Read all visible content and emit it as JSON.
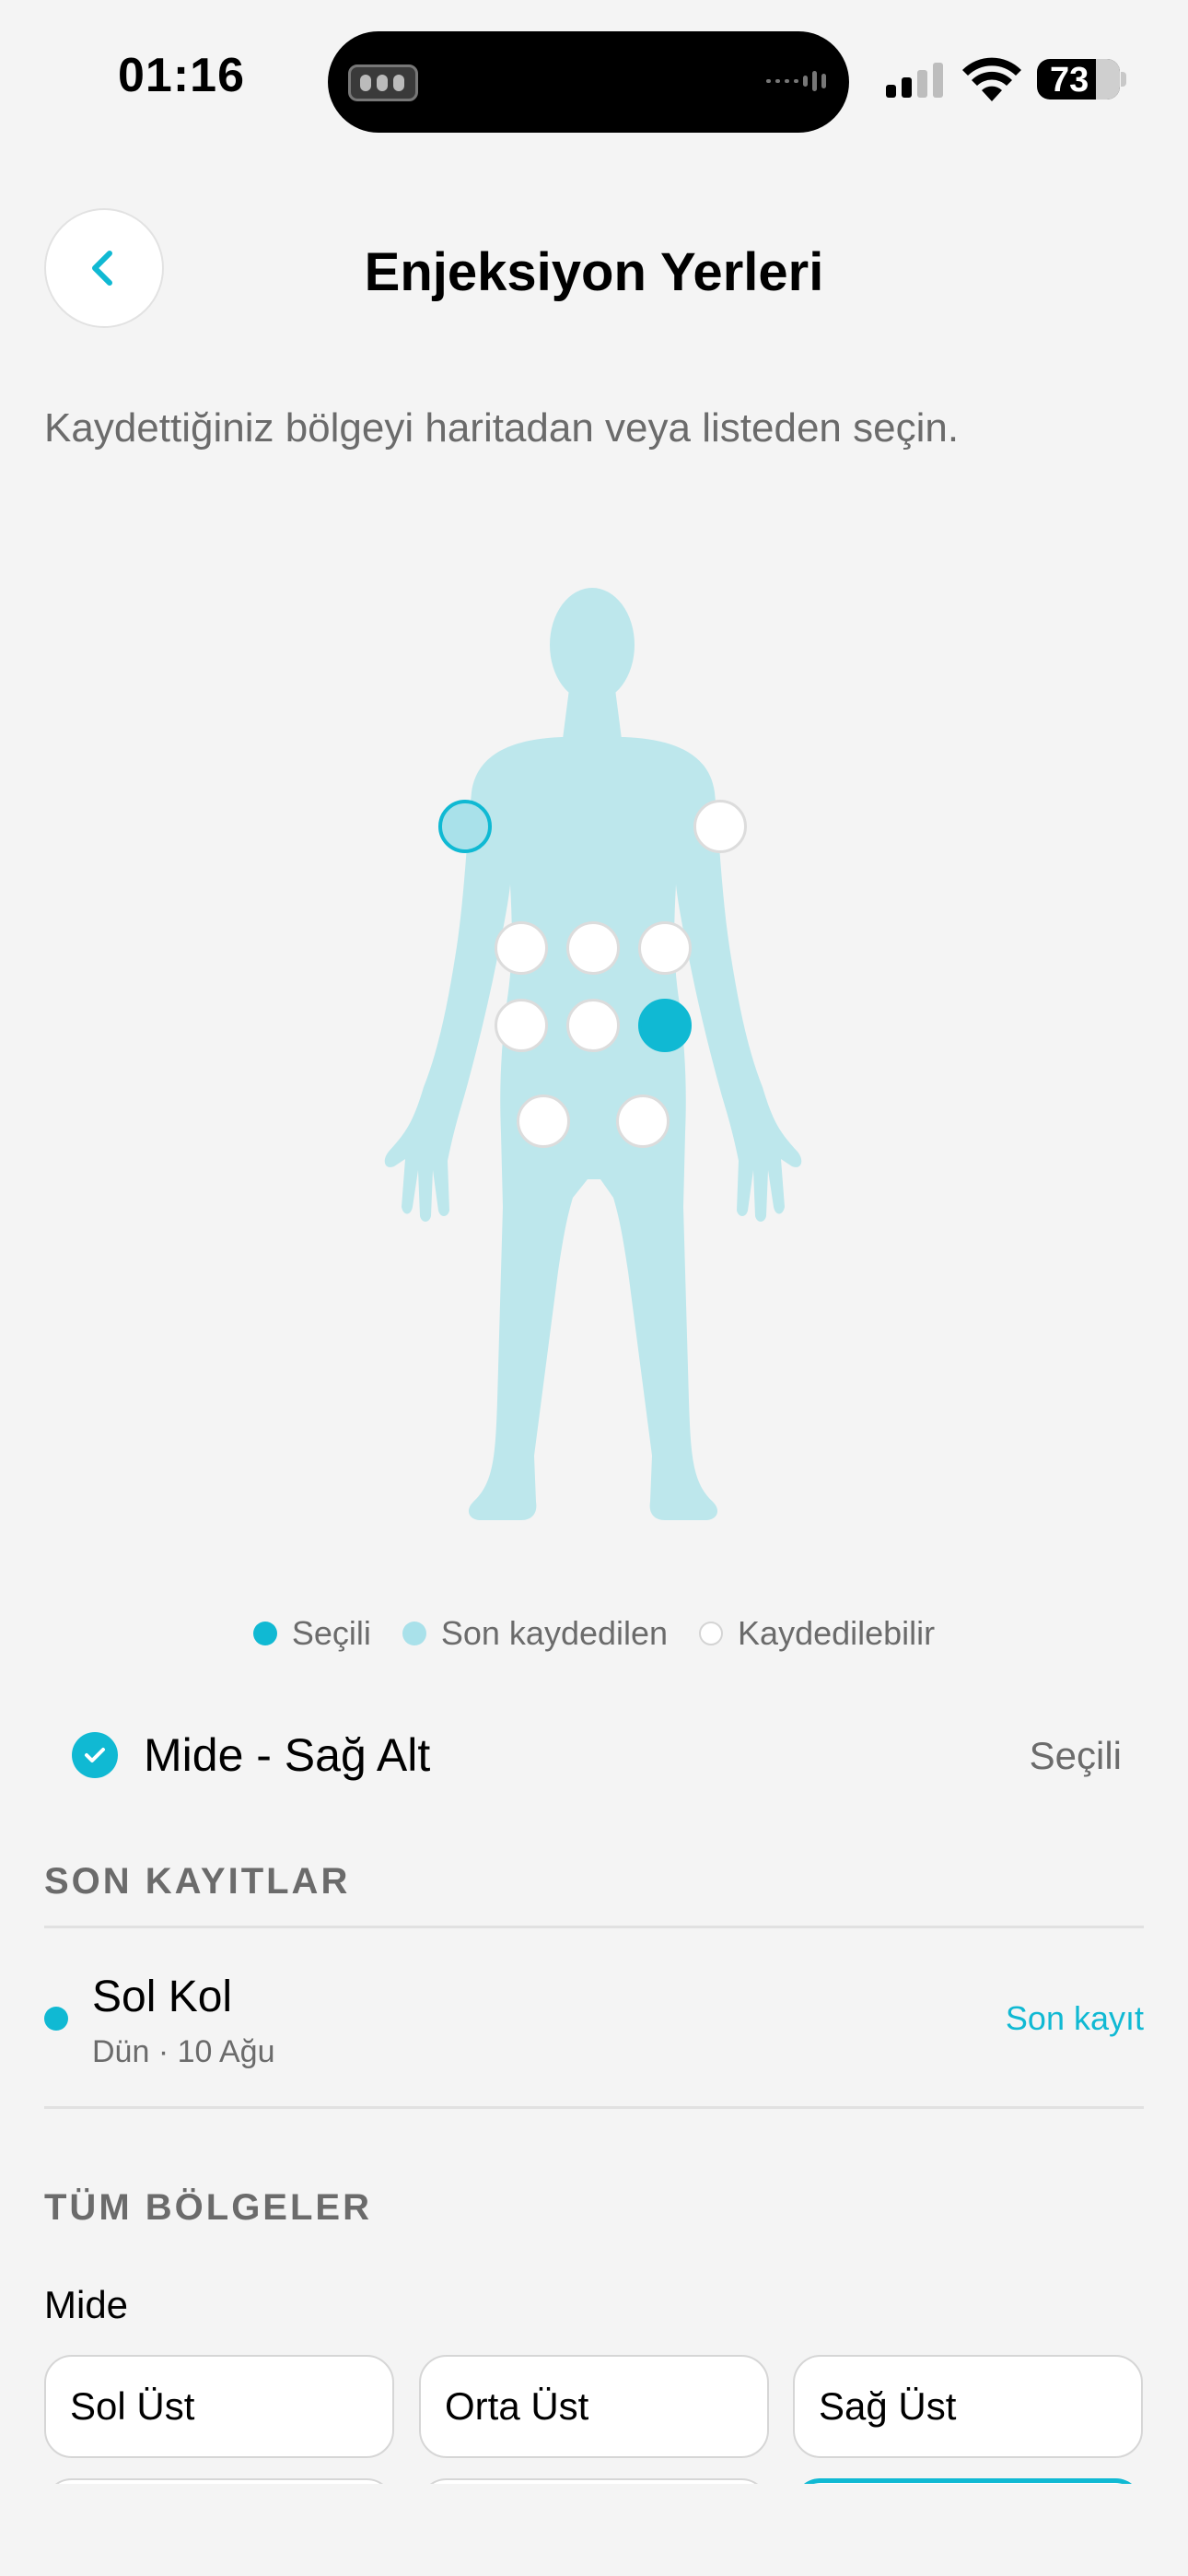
{
  "status_bar": {
    "time": "01:16",
    "battery": "73"
  },
  "header": {
    "title": "Enjeksiyon Yerleri",
    "back_icon": "chevron-left-icon"
  },
  "subtitle": "Kaydettiğiniz bölgeyi haritadan veya listeden seçin.",
  "colors": {
    "accent": "#10b9d3",
    "body": "#bde7ec",
    "recent": "#a9e1ea"
  },
  "map": {
    "spots": [
      {
        "zone": "Sol Kol",
        "state": "recent"
      },
      {
        "zone": "Sağ Kol",
        "state": "available"
      },
      {
        "zone": "Mide - Sol Üst",
        "state": "available"
      },
      {
        "zone": "Mide - Orta Üst",
        "state": "available"
      },
      {
        "zone": "Mide - Sağ Üst",
        "state": "available"
      },
      {
        "zone": "Mide - Sol Alt",
        "state": "available"
      },
      {
        "zone": "Mide - Orta Alt",
        "state": "available"
      },
      {
        "zone": "Mide - Sağ Alt",
        "state": "selected"
      },
      {
        "zone": "Sol Bacak",
        "state": "available"
      },
      {
        "zone": "Sağ Bacak",
        "state": "available"
      }
    ]
  },
  "legend": {
    "selected": "Seçili",
    "recent": "Son kaydedilen",
    "available": "Kaydedilebilir"
  },
  "selection": {
    "label": "Mide - Sağ Alt",
    "status": "Seçili"
  },
  "recent_section": {
    "heading": "SON KAYITLAR",
    "items": [
      {
        "title": "Sol Kol",
        "subtitle": "Dün · 10 Ağu",
        "tag": "Son kayıt"
      }
    ]
  },
  "all_section": {
    "heading": "TÜM BÖLGELER",
    "groups": [
      {
        "label": "Mide",
        "zones": [
          "Sol Üst",
          "Orta Üst",
          "Sağ Üst"
        ]
      }
    ]
  }
}
